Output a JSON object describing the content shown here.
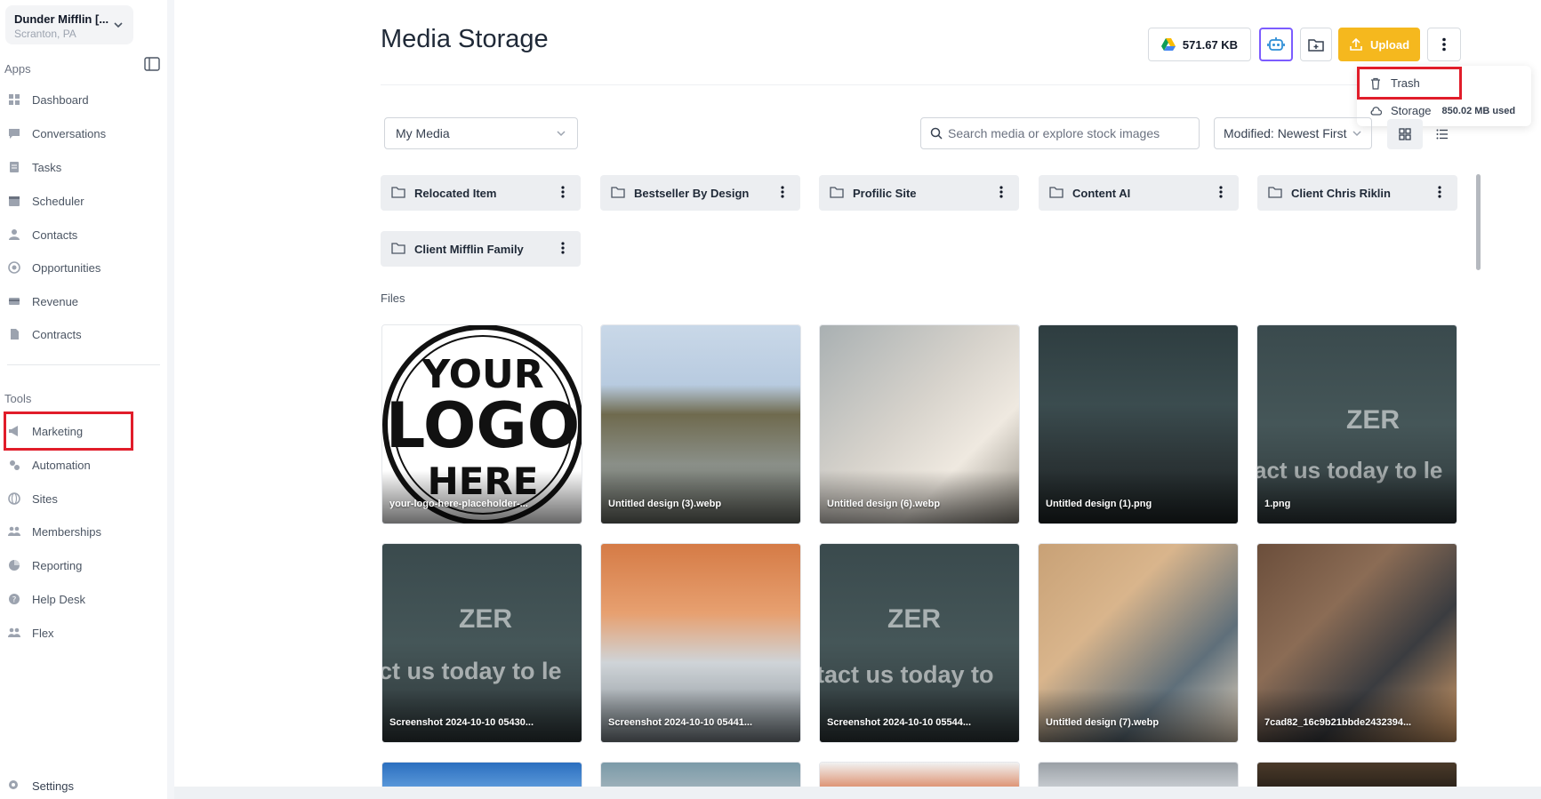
{
  "account": {
    "name": "Dunder Mifflin [...",
    "location": "Scranton, PA"
  },
  "sidebar": {
    "apps_label": "Apps",
    "tools_label": "Tools",
    "apps": [
      {
        "label": "Dashboard",
        "icon": "dashboard-icon"
      },
      {
        "label": "Conversations",
        "icon": "chat-icon"
      },
      {
        "label": "Tasks",
        "icon": "tasks-icon"
      },
      {
        "label": "Scheduler",
        "icon": "calendar-icon"
      },
      {
        "label": "Contacts",
        "icon": "person-icon"
      },
      {
        "label": "Opportunities",
        "icon": "target-icon"
      },
      {
        "label": "Revenue",
        "icon": "card-icon"
      },
      {
        "label": "Contracts",
        "icon": "document-icon"
      }
    ],
    "tools": [
      {
        "label": "Marketing",
        "icon": "megaphone-icon"
      },
      {
        "label": "Automation",
        "icon": "gears-icon"
      },
      {
        "label": "Sites",
        "icon": "globe-icon"
      },
      {
        "label": "Memberships",
        "icon": "group-icon"
      },
      {
        "label": "Reporting",
        "icon": "pie-chart-icon"
      },
      {
        "label": "Help Desk",
        "icon": "help-icon"
      },
      {
        "label": "Flex",
        "icon": "group-icon"
      }
    ],
    "settings_label": "Settings"
  },
  "page": {
    "title": "Media Storage"
  },
  "toolbar": {
    "drive_size": "571.67 KB",
    "upload_label": "Upload"
  },
  "menu": {
    "trash_label": "Trash",
    "storage_label": "Storage",
    "storage_used": "850.02 MB used"
  },
  "filters": {
    "media_source": "My Media",
    "search_placeholder": "Search media or explore stock images",
    "sort": "Modified: Newest First"
  },
  "folders": [
    "Relocated Item",
    "Bestseller By Design",
    "Profilic Site",
    "Content AI",
    "Client Chris Riklin",
    "Client Mifflin Family"
  ],
  "files_label": "Files",
  "files": [
    {
      "name": "your-logo-here-placeholder-...",
      "overlay": ""
    },
    {
      "name": "Untitled design (3).webp",
      "overlay": ""
    },
    {
      "name": "Untitled design (6).webp",
      "overlay": ""
    },
    {
      "name": "Untitled design (1).png",
      "overlay": ""
    },
    {
      "name": "1.png",
      "overlay": "act us today to le"
    },
    {
      "name": "Screenshot 2024-10-10 05430...",
      "overlay": "ct us today to le"
    },
    {
      "name": "Screenshot 2024-10-10 05441...",
      "overlay": ""
    },
    {
      "name": "Screenshot 2024-10-10 05544...",
      "overlay": "tact us today to"
    },
    {
      "name": "Untitled design (7).webp",
      "overlay": ""
    },
    {
      "name": "7cad82_16c9b21bbde2432394...",
      "overlay": ""
    }
  ],
  "logo_text": {
    "line1": "YOUR",
    "line2": "LOGO",
    "line3": "HERE"
  },
  "alpha_text": "ZER",
  "colors": {
    "upload": "#f5b81e",
    "highlight": "#e11d2a",
    "ai_border": "#7c5cff"
  }
}
